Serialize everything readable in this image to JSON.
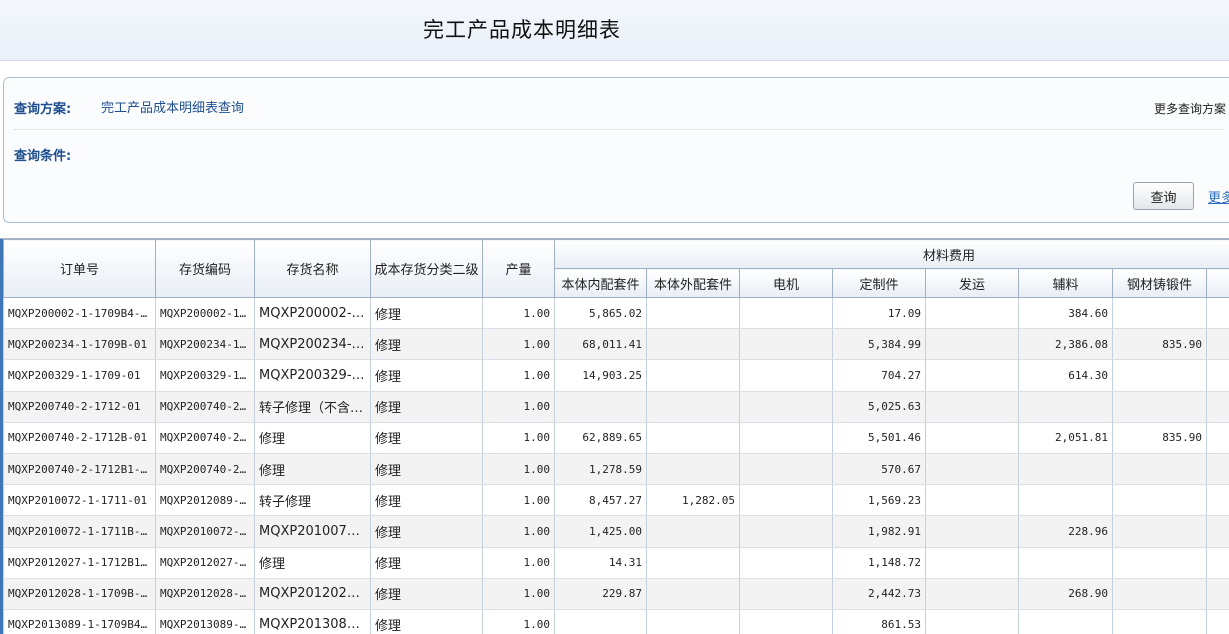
{
  "page": {
    "title": "完工产品成本明细表"
  },
  "query": {
    "plan_label": "查询方案:",
    "plan_value": "完工产品成本明细表查询",
    "more_plans": "更多查询方案",
    "condition_label": "查询条件:",
    "search_button": "查询",
    "more_link": "更多"
  },
  "table": {
    "columns": {
      "order_no": "订单号",
      "inv_code": "存货编码",
      "inv_name": "存货名称",
      "category": "成本存货分类二级",
      "qty": "产量",
      "material_group": "材料费用",
      "inner_kit": "本体内配套件",
      "outer_kit": "本体外配套件",
      "motor": "电机",
      "custom": "定制件",
      "shipping": "发运",
      "aux": "辅料",
      "steel": "钢材铸锻件"
    },
    "rows": [
      {
        "order_no": "MQXP200002-1-1709B4-01",
        "inv_code": "MQXP200002-1…",
        "inv_name": "MQXP200002-1-17…",
        "category": "修理",
        "qty": "1.00",
        "inner_kit": "5,865.02",
        "outer_kit": "",
        "motor": "",
        "custom": "17.09",
        "shipping": "",
        "aux": "384.60",
        "steel": ""
      },
      {
        "order_no": "MQXP200234-1-1709B-01",
        "inv_code": "MQXP200234-1…",
        "inv_name": "MQXP200234-1-17…",
        "category": "修理",
        "qty": "1.00",
        "inner_kit": "68,011.41",
        "outer_kit": "",
        "motor": "",
        "custom": "5,384.99",
        "shipping": "",
        "aux": "2,386.08",
        "steel": "835.90"
      },
      {
        "order_no": "MQXP200329-1-1709-01",
        "inv_code": "MQXP200329-1…",
        "inv_name": "MQXP200329-1-17…",
        "category": "修理",
        "qty": "1.00",
        "inner_kit": "14,903.25",
        "outer_kit": "",
        "motor": "",
        "custom": "704.27",
        "shipping": "",
        "aux": "614.30",
        "steel": ""
      },
      {
        "order_no": "MQXP200740-2-1712-01",
        "inv_code": "MQXP200740-2…",
        "inv_name": "转子修理（不含…",
        "category": "修理",
        "qty": "1.00",
        "inner_kit": "",
        "outer_kit": "",
        "motor": "",
        "custom": "5,025.63",
        "shipping": "",
        "aux": "",
        "steel": ""
      },
      {
        "order_no": "MQXP200740-2-1712B-01",
        "inv_code": "MQXP200740-2…",
        "inv_name": "修理",
        "category": "修理",
        "qty": "1.00",
        "inner_kit": "62,889.65",
        "outer_kit": "",
        "motor": "",
        "custom": "5,501.46",
        "shipping": "",
        "aux": "2,051.81",
        "steel": "835.90"
      },
      {
        "order_no": "MQXP200740-2-1712B1-01",
        "inv_code": "MQXP200740-2…",
        "inv_name": "修理",
        "category": "修理",
        "qty": "1.00",
        "inner_kit": "1,278.59",
        "outer_kit": "",
        "motor": "",
        "custom": "570.67",
        "shipping": "",
        "aux": "",
        "steel": ""
      },
      {
        "order_no": "MQXP2010072-1-1711-01",
        "inv_code": "MQXP2012089-…",
        "inv_name": "转子修理",
        "category": "修理",
        "qty": "1.00",
        "inner_kit": "8,457.27",
        "outer_kit": "1,282.05",
        "motor": "",
        "custom": "1,569.23",
        "shipping": "",
        "aux": "",
        "steel": ""
      },
      {
        "order_no": "MQXP2010072-1-1711B-01",
        "inv_code": "MQXP2010072-…",
        "inv_name": "MQXP2010072-1-1…",
        "category": "修理",
        "qty": "1.00",
        "inner_kit": "1,425.00",
        "outer_kit": "",
        "motor": "",
        "custom": "1,982.91",
        "shipping": "",
        "aux": "228.96",
        "steel": ""
      },
      {
        "order_no": "MQXP2012027-1-1712B1…",
        "inv_code": "MQXP2012027-…",
        "inv_name": "修理",
        "category": "修理",
        "qty": "1.00",
        "inner_kit": "14.31",
        "outer_kit": "",
        "motor": "",
        "custom": "1,148.72",
        "shipping": "",
        "aux": "",
        "steel": ""
      },
      {
        "order_no": "MQXP2012028-1-1709B-01",
        "inv_code": "MQXP2012028-…",
        "inv_name": "MQXP2012028-1-1…",
        "category": "修理",
        "qty": "1.00",
        "inner_kit": "229.87",
        "outer_kit": "",
        "motor": "",
        "custom": "2,442.73",
        "shipping": "",
        "aux": "268.90",
        "steel": ""
      },
      {
        "order_no": "MQXP2013089-1-1709B4…",
        "inv_code": "MQXP2013089-…",
        "inv_name": "MQXP2013089-1-1…",
        "category": "修理",
        "qty": "1.00",
        "inner_kit": "",
        "outer_kit": "",
        "motor": "",
        "custom": "861.53",
        "shipping": "",
        "aux": "",
        "steel": ""
      }
    ]
  }
}
